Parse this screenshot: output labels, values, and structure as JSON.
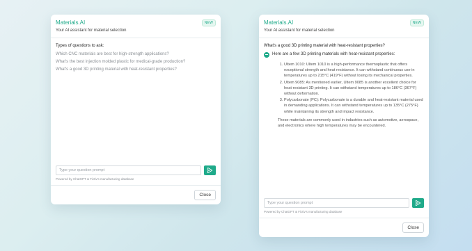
{
  "left_card": {
    "brand": "Materials.AI",
    "badge": "NEW",
    "subtitle": "Your AI assistant for material selection",
    "questions_title": "Types of questions to ask:",
    "questions": [
      "Which CNC materials are best for high-strength applications?",
      "What's the best injection molded plastic for medical-grade production?",
      "What's a good 3D printing material with heat-resistant properties?"
    ],
    "input_placeholder": "Type your question prompt",
    "powered_by": "Powered by ChatGPT & Fictiv's manufacturing database",
    "close_label": "Close"
  },
  "right_card": {
    "brand": "Materials.AI",
    "badge": "NEW",
    "subtitle": "Your AI assistant for material selection",
    "question": "What's a good 3D printing material with heat-resistant properties?",
    "intro": "Here are a few 3D printing materials with heat-resistant properties:",
    "answers": [
      "Ultem 1010: Ultem 1010 is a high-performance thermoplastic that offers exceptional strength and heat resistance. It can withstand continuous use in temperatures up to 215°C (419°F) without losing its mechanical properties.",
      "Ultem 9085: As mentioned earlier, Ultem 9085 is another excellent choice for heat-resistant 3D printing. It can withstand temperatures up to 186°C (367°F) without deformation.",
      "Polycarbonate (PC): Polycarbonate is a durable and heat-resistant material used in demanding applications. It can withstand temperatures up to 135°C (275°F) while maintaining its strength and impact resistance."
    ],
    "summary": "These materials are commonly used in industries such as automotive, aerospace, and electronics where high temperatures may be encountered.",
    "input_placeholder": "Type your question prompt",
    "powered_by": "Powered by ChatGPT & Fictiv's manufacturing database",
    "close_label": "Close"
  },
  "colors": {
    "accent": "#1faa8a",
    "badge_bg": "#e6f7f1"
  },
  "icons": {
    "send": "send-icon",
    "bot": "bot-avatar-icon"
  }
}
